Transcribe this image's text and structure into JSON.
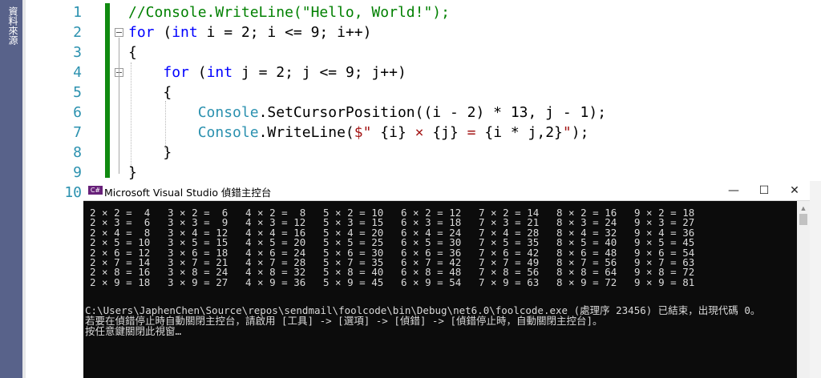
{
  "side_panel": {
    "label": "資料來源"
  },
  "editor": {
    "line_numbers": [
      "1",
      "2",
      "3",
      "4",
      "5",
      "6",
      "7",
      "8",
      "9",
      "10"
    ],
    "lines": [
      [
        {
          "c": "cm",
          "t": "//Console.WriteLine(\"Hello, World!\");"
        }
      ],
      [
        {
          "c": "kw",
          "t": "for"
        },
        {
          "c": "",
          "t": " ("
        },
        {
          "c": "kw",
          "t": "int"
        },
        {
          "c": "",
          "t": " i = 2; i <= 9; i++)"
        }
      ],
      [
        {
          "c": "",
          "t": "{"
        }
      ],
      [
        {
          "c": "",
          "t": "    "
        },
        {
          "c": "kw",
          "t": "for"
        },
        {
          "c": "",
          "t": " ("
        },
        {
          "c": "kw",
          "t": "int"
        },
        {
          "c": "",
          "t": " j = 2; j <= 9; j++)"
        }
      ],
      [
        {
          "c": "",
          "t": "    {"
        }
      ],
      [
        {
          "c": "",
          "t": "        "
        },
        {
          "c": "cls",
          "t": "Console"
        },
        {
          "c": "",
          "t": ".SetCursorPosition((i - 2) * 13, j - 1);"
        }
      ],
      [
        {
          "c": "",
          "t": "        "
        },
        {
          "c": "cls",
          "t": "Console"
        },
        {
          "c": "",
          "t": ".WriteLine("
        },
        {
          "c": "str",
          "t": "$\" "
        },
        {
          "c": "",
          "t": "{i}"
        },
        {
          "c": "str",
          "t": " × "
        },
        {
          "c": "",
          "t": "{j}"
        },
        {
          "c": "str",
          "t": " = "
        },
        {
          "c": "",
          "t": "{i * j,2}"
        },
        {
          "c": "str",
          "t": "\""
        },
        {
          "c": "",
          "t": ");"
        }
      ],
      [
        {
          "c": "",
          "t": "    }"
        }
      ],
      [
        {
          "c": "",
          "t": "}"
        }
      ],
      []
    ]
  },
  "console_window": {
    "title": "Microsoft Visual Studio 偵錯主控台",
    "icon_label": "C#",
    "minimize": "—",
    "maximize": "☐",
    "close": "✕",
    "output_rows": [
      [
        "2 × 2 =  4",
        "3 × 2 =  6",
        "4 × 2 =  8",
        "5 × 2 = 10",
        "6 × 2 = 12",
        "7 × 2 = 14",
        "8 × 2 = 16",
        "9 × 2 = 18"
      ],
      [
        "2 × 3 =  6",
        "3 × 3 =  9",
        "4 × 3 = 12",
        "5 × 3 = 15",
        "6 × 3 = 18",
        "7 × 3 = 21",
        "8 × 3 = 24",
        "9 × 3 = 27"
      ],
      [
        "2 × 4 =  8",
        "3 × 4 = 12",
        "4 × 4 = 16",
        "5 × 4 = 20",
        "6 × 4 = 24",
        "7 × 4 = 28",
        "8 × 4 = 32",
        "9 × 4 = 36"
      ],
      [
        "2 × 5 = 10",
        "3 × 5 = 15",
        "4 × 5 = 20",
        "5 × 5 = 25",
        "6 × 5 = 30",
        "7 × 5 = 35",
        "8 × 5 = 40",
        "9 × 5 = 45"
      ],
      [
        "2 × 6 = 12",
        "3 × 6 = 18",
        "4 × 6 = 24",
        "5 × 6 = 30",
        "6 × 6 = 36",
        "7 × 6 = 42",
        "8 × 6 = 48",
        "9 × 6 = 54"
      ],
      [
        "2 × 7 = 14",
        "3 × 7 = 21",
        "4 × 7 = 28",
        "5 × 7 = 35",
        "6 × 7 = 42",
        "7 × 7 = 49",
        "8 × 7 = 56",
        "9 × 7 = 63"
      ],
      [
        "2 × 8 = 16",
        "3 × 8 = 24",
        "4 × 8 = 32",
        "5 × 8 = 40",
        "6 × 8 = 48",
        "7 × 8 = 56",
        "8 × 8 = 64",
        "9 × 8 = 72"
      ],
      [
        "2 × 9 = 18",
        "3 × 9 = 27",
        "4 × 9 = 36",
        "5 × 9 = 45",
        "6 × 9 = 54",
        "7 × 9 = 63",
        "8 × 9 = 72",
        "9 × 9 = 81"
      ]
    ],
    "exit_message": "C:\\Users\\JaphenChen\\Source\\repos\\sendmail\\foolcode\\bin\\Debug\\net6.0\\foolcode.exe (處理序 23456) 已結束，出現代碼 0。",
    "hint_message": "若要在偵錯停止時自動關閉主控台，請啟用 [工具] -> [選項] -> [偵錯] -> [偵錯停止時，自動關閉主控台]。",
    "press_key_message": "按任意鍵關閉此視窗…"
  },
  "colors": {
    "keyword": "#0000ff",
    "comment": "#008000",
    "class_name": "#2b91af",
    "string": "#a31515",
    "line_number": "#2b91af",
    "change_bar": "#108a10",
    "console_bg": "#0c0c0c",
    "console_text": "#d9d9d9",
    "side_panel": "#58628a"
  }
}
